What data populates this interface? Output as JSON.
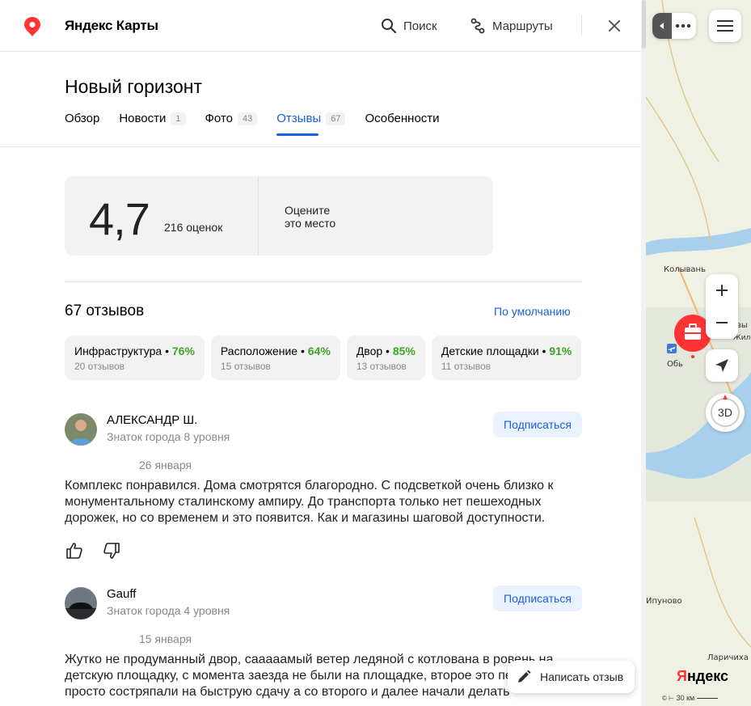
{
  "app": {
    "brand": "Яндекс Карты",
    "search_label": "Поиск",
    "routes_label": "Маршруты"
  },
  "place": {
    "title": "Новый горизонт"
  },
  "tabs": [
    {
      "label": "Обзор",
      "count": ""
    },
    {
      "label": "Новости",
      "count": "1"
    },
    {
      "label": "Фото",
      "count": "43"
    },
    {
      "label": "Отзывы",
      "count": "67"
    },
    {
      "label": "Особенности",
      "count": ""
    }
  ],
  "rating": {
    "value": "4,7",
    "count_text": "216 оценок",
    "cta_line1": "Оцените",
    "cta_line2": "это место"
  },
  "reviews": {
    "title": "67 отзывов",
    "sort_label": "По умолчанию",
    "aspects": [
      {
        "name": "Инфраструктура",
        "percent": "76%",
        "count": "20 отзывов"
      },
      {
        "name": "Расположение",
        "percent": "64%",
        "count": "15 отзывов"
      },
      {
        "name": "Двор",
        "percent": "85%",
        "count": "13 отзывов"
      },
      {
        "name": "Детские площадки",
        "percent": "91%",
        "count": "11 отзывов"
      }
    ],
    "items": [
      {
        "author": "АЛЕКСАНДР Ш.",
        "level": "Знаток города 8 уровня",
        "subscribe": "Подписаться",
        "date": "26 января",
        "text": "Комплекс понравился. Дома смотрятся благородно. С подсветкой очень близко к монументальному сталинскому ампиру. До транспорта только нет пешеходных дорожек, но со временем и это появится. Как и магазины шаговой доступности."
      },
      {
        "author": "Gauff",
        "level": "Знаток города 4 уровня",
        "subscribe": "Подписаться",
        "date": "15 января",
        "text": "Жутко не продуманный двор, саааaамый ветер ледяной с котлована в ровень на детскую площадку, с момента заезда не были на площадке, второе это пе... который просто состряпали на быструю сдачу а со второго и далее начали делать"
      }
    ],
    "write_label": "Написать отзыв"
  },
  "map": {
    "labels": {
      "kolyvan": "Колывань",
      "ob": "Обь",
      "vy": "вы",
      "zhiloy": "Жилой",
      "iipunovo": "Ипуново",
      "larichikha": "Ларичиха"
    },
    "btn_3d": "3D",
    "logo": "Яндекс",
    "scale": "30 км"
  },
  "colors": {
    "accent": "#1a5fe0",
    "green": "#3ba526",
    "brand_red": "#f33"
  }
}
